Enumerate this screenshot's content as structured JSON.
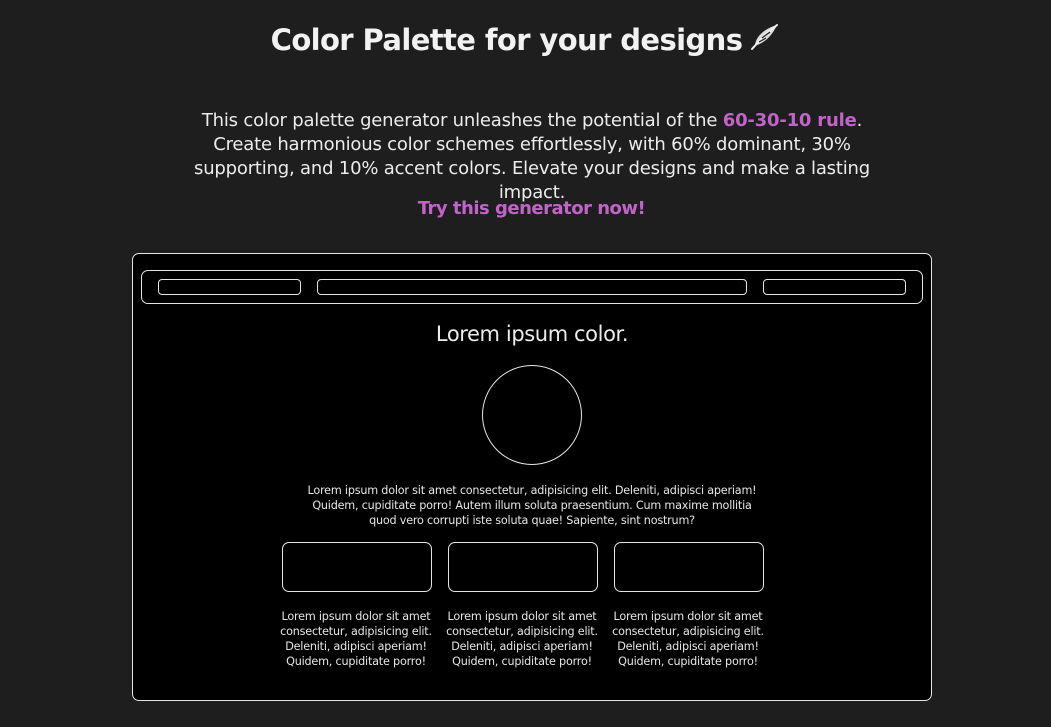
{
  "header": {
    "title": "Color Palette for your designs",
    "title_icon": "feather-quill-icon"
  },
  "intro": {
    "before": "This color palette generator unleashes the potential of the ",
    "highlight": "60-30-10 rule",
    "after": ". Create harmonious color schemes effortlessly, with 60% dominant, 30% supporting, and 10% accent colors. Elevate your designs and make a lasting impact."
  },
  "cta": {
    "label": "Try this generator now!"
  },
  "preview": {
    "heading": "Lorem ipsum color.",
    "paragraph": "Lorem ipsum dolor sit amet consectetur, adipisicing elit. Deleniti, adipisci aperiam! Quidem, cupiditate porro! Autem illum soluta praesentium. Cum maxime mollitia quod vero corrupti iste soluta quae! Sapiente, sint nostrum?",
    "cards": [
      {
        "text": "Lorem ipsum dolor sit amet consectetur, adipisicing elit. Deleniti, adipisci aperiam! Quidem, cupiditate porro!"
      },
      {
        "text": "Lorem ipsum dolor sit amet consectetur, adipisicing elit. Deleniti, adipisci aperiam! Quidem, cupiditate porro!"
      },
      {
        "text": "Lorem ipsum dolor sit amet consectetur, adipisicing elit. Deleniti, adipisci aperiam! Quidem, cupiditate porro!"
      }
    ]
  },
  "colors": {
    "background": "#1e1e1e",
    "text": "#f2f2f2",
    "accent": "#c065c7",
    "preview_background": "#000000",
    "outline": "#e5e5e5"
  }
}
